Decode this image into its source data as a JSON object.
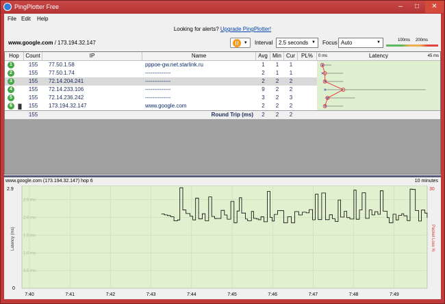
{
  "window": {
    "title": "PingPlotter Free",
    "controls": {
      "minimize": "–",
      "maximize": "□",
      "close": "✕"
    }
  },
  "menu": [
    "File",
    "Edit",
    "Help"
  ],
  "alert": {
    "text": "Looking for alerts?",
    "link": "Upgrade PingPlotter!"
  },
  "toolbar": {
    "target_host": "www.google.com",
    "target_sep": " / ",
    "target_ip": "173.194.32.147",
    "interval_label": "Interval",
    "interval_value": "2.5 seconds",
    "focus_label": "Focus",
    "focus_value": "Auto",
    "scale": {
      "label_mid": "100ms",
      "label_high": "200ms",
      "colors": {
        "good": "#5cb85c",
        "warn": "#f0ad4e",
        "bad": "#e04343"
      }
    }
  },
  "table": {
    "columns": [
      "Hop",
      "Count",
      "IP",
      "Name",
      "Avg",
      "Min",
      "Cur",
      "PL%",
      "Latency"
    ],
    "latency_min_label": "0 ms",
    "latency_max_label": "45 ms",
    "rows": [
      {
        "hop": "1",
        "count": "155",
        "ip": "77.50.1.58",
        "name": "pppoe-gw.net.starlink.ru",
        "avg": "1",
        "min": "1",
        "cur": "1",
        "pl": "",
        "selected": false
      },
      {
        "hop": "2",
        "count": "155",
        "ip": "77.50.1.74",
        "name": "--------------",
        "avg": "2",
        "min": "1",
        "cur": "1",
        "pl": "",
        "selected": false
      },
      {
        "hop": "3",
        "count": "155",
        "ip": "72.14.204.241",
        "name": "--------------",
        "avg": "2",
        "min": "2",
        "cur": "2",
        "pl": "",
        "selected": true
      },
      {
        "hop": "4",
        "count": "155",
        "ip": "72.14.233.106",
        "name": "--------------",
        "avg": "9",
        "min": "2",
        "cur": "2",
        "pl": "",
        "selected": false
      },
      {
        "hop": "5",
        "count": "155",
        "ip": "72.14.236.242",
        "name": "--------------",
        "avg": "3",
        "min": "2",
        "cur": "3",
        "pl": "",
        "selected": false
      },
      {
        "hop": "6",
        "count": "155",
        "ip": "173.194.32.147",
        "name": "www.google.com",
        "avg": "2",
        "min": "2",
        "cur": "2",
        "pl": "",
        "selected": false
      }
    ],
    "summary": {
      "count": "155",
      "label": "Round Trip (ms)",
      "avg": "2",
      "min": "2",
      "cur": "2"
    }
  },
  "graph": {
    "title": "www.google.com (173.194.32.147) hop 6",
    "span": "10 minutes",
    "y_label": "Latency (ms)",
    "y2_label": "Packet Loss %",
    "y_top": "2.9",
    "y_bottom": "0",
    "y2_top": "30",
    "y_ticks": [
      "2.5 ms",
      "2.0 ms",
      "1.5 ms",
      "1.0 ms",
      "0.5 ms"
    ],
    "x_ticks": [
      "7:40",
      "7:41",
      "7:42",
      "7:43",
      "7:44",
      "7:45",
      "7:46",
      "7:47",
      "7:48",
      "7:49"
    ]
  },
  "colors": {
    "titlebar": "#c03a3a",
    "latency_bg": "#dff0d0",
    "graph_bg": "#e1f1d0",
    "hop_badge": "#47a447",
    "line": "#000000",
    "loss": "#d32f2f"
  }
}
